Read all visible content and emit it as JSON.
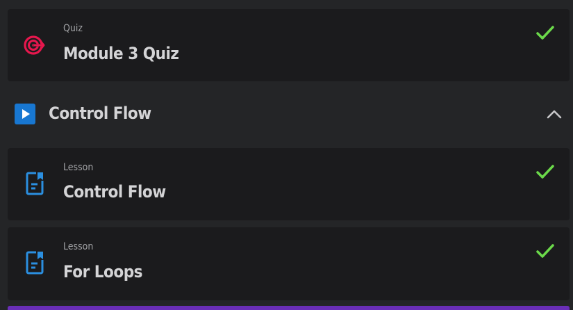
{
  "items": [
    {
      "label": "Quiz",
      "title": "Module 3 Quiz",
      "icon": "target-icon",
      "status": "completed"
    },
    {
      "label": "Lesson",
      "title": "Control Flow",
      "icon": "document-icon",
      "status": "completed"
    },
    {
      "label": "Lesson",
      "title": "For Loops",
      "icon": "document-icon",
      "status": "completed"
    }
  ],
  "section": {
    "title": "Control Flow",
    "icon": "play-icon",
    "expanded": true
  },
  "colors": {
    "check": "#6bd94a",
    "quiz_icon": "#e6174d",
    "lesson_icon": "#2b8fe0",
    "section_icon": "#1877d1",
    "accent_bar": "#6a2fb8"
  }
}
